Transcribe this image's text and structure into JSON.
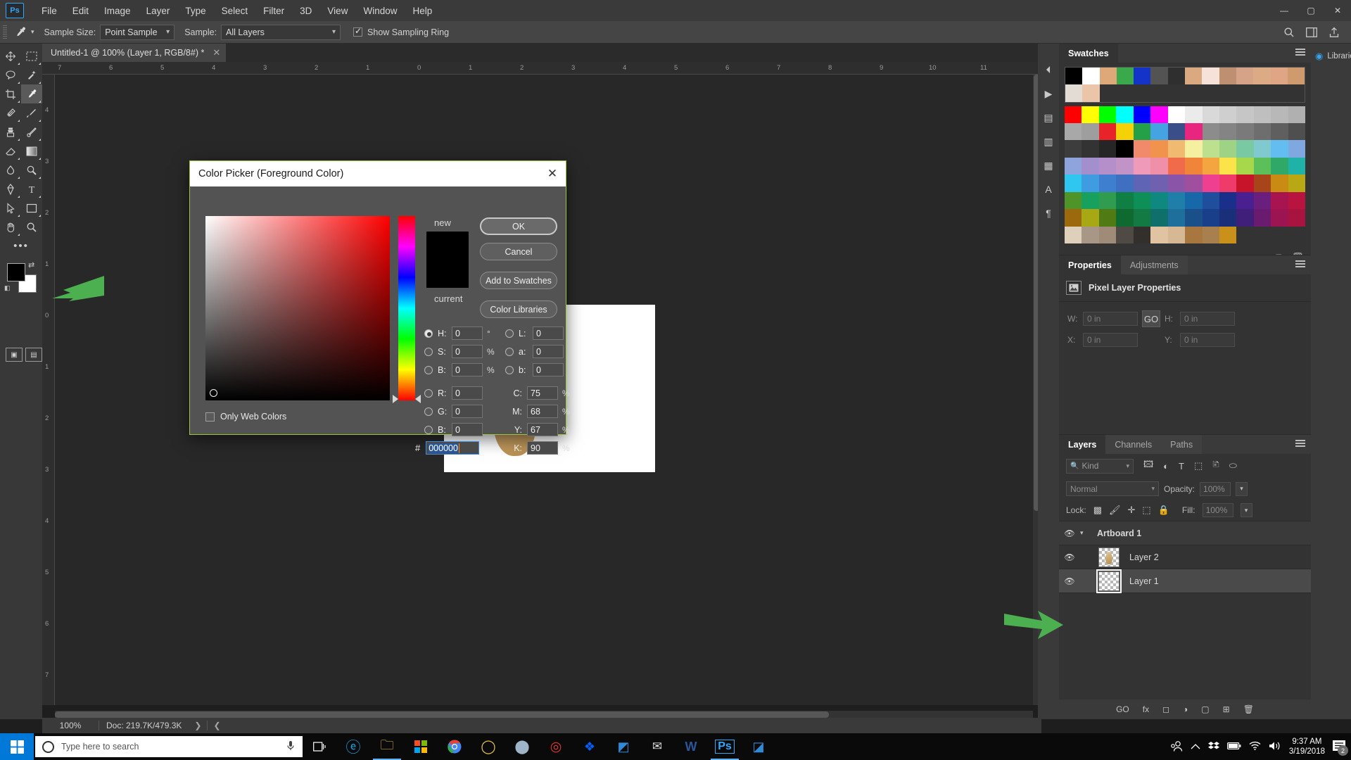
{
  "app": {
    "name": "Photoshop",
    "logo_text": "Ps"
  },
  "menubar": {
    "items": [
      "File",
      "Edit",
      "Image",
      "Layer",
      "Type",
      "Select",
      "Filter",
      "3D",
      "View",
      "Window",
      "Help"
    ],
    "window_controls": [
      "—",
      "▢",
      "✕"
    ]
  },
  "options_bar": {
    "sample_size_label": "Sample Size:",
    "sample_size_value": "Point Sample",
    "sample_label": "Sample:",
    "sample_value": "All Layers",
    "show_sampling_ring_label": "Show Sampling Ring",
    "show_sampling_ring_checked": true
  },
  "document": {
    "tab_title": "Untitled-1 @ 100% (Layer 1, RGB/8#) *",
    "tab_close": "✕"
  },
  "ruler": {
    "h_ticks": [
      "7",
      "6",
      "5",
      "4",
      "3",
      "2",
      "1",
      "0",
      "1",
      "2",
      "3",
      "4",
      "5",
      "6",
      "7",
      "8",
      "9",
      "10",
      "11"
    ],
    "v_ticks": [
      "4",
      "3",
      "2",
      "1",
      "0",
      "1",
      "2",
      "3",
      "4",
      "5",
      "6",
      "7"
    ]
  },
  "status_bar": {
    "zoom": "100%",
    "doc_info": "Doc: 219.7K/479.3K",
    "arrow_right": "❯",
    "arrow_left": "❮"
  },
  "color_picker": {
    "title": "Color Picker (Foreground Color)",
    "close_label": "✕",
    "new_label": "new",
    "current_label": "current",
    "new_color": "#000000",
    "current_color": "#000000",
    "buttons": [
      {
        "label": "OK",
        "primary": true
      },
      {
        "label": "Cancel",
        "primary": false
      },
      {
        "label": "Add to Swatches",
        "primary": false
      },
      {
        "label": "Color Libraries",
        "primary": false
      }
    ],
    "hsb": [
      {
        "label": "H:",
        "value": "0",
        "unit": "°",
        "selected": true
      },
      {
        "label": "S:",
        "value": "0",
        "unit": "%",
        "selected": false
      },
      {
        "label": "B:",
        "value": "0",
        "unit": "%",
        "selected": false
      }
    ],
    "rgb": [
      {
        "label": "R:",
        "value": "0",
        "unit": "",
        "selected": false
      },
      {
        "label": "G:",
        "value": "0",
        "unit": "",
        "selected": false
      },
      {
        "label": "B:",
        "value": "0",
        "unit": "",
        "selected": false
      }
    ],
    "lab": [
      {
        "label": "L:",
        "value": "0",
        "unit": "",
        "selected": false
      },
      {
        "label": "a:",
        "value": "0",
        "unit": "",
        "selected": false
      },
      {
        "label": "b:",
        "value": "0",
        "unit": "",
        "selected": false
      }
    ],
    "cmyk": [
      {
        "label": "C:",
        "value": "75",
        "unit": "%"
      },
      {
        "label": "M:",
        "value": "68",
        "unit": "%"
      },
      {
        "label": "Y:",
        "value": "67",
        "unit": "%"
      },
      {
        "label": "K:",
        "value": "90",
        "unit": "%"
      }
    ],
    "only_web_colors_label": "Only Web Colors",
    "only_web_colors_checked": false,
    "hex_hash": "#",
    "hex_value": "000000",
    "accent_border": "#9bc53d"
  },
  "swatches_panel": {
    "tab_label": "Swatches",
    "recent": [
      "#000000",
      "#ffffff",
      "#dfa878",
      "#3aa94b",
      "#1433c8",
      "#535353",
      "#2f2f2f",
      "#dba97f",
      "#f7e2da",
      "#bf8f72",
      "#d6a388",
      "#dcab85",
      "#e0a585",
      "#cf9a6e",
      "#e3dcd4",
      "#eac5a8"
    ],
    "grid": [
      [
        "#ff0000",
        "#ffff00",
        "#00ff00",
        "#00ffff",
        "#0000ff",
        "#ff00ff",
        "#ffffff",
        "#ebebeb",
        "#d9d9d9",
        "#cfcfcf",
        "#c6c6c6",
        "#bfbfbf",
        "#b8b8b8",
        "#b0b0b0"
      ],
      [
        "#a8a8a8",
        "#9e9e9e",
        "#e8242a",
        "#f5d108",
        "#24a148",
        "#44a3e0",
        "#3a4f8a",
        "#e8267f",
        "#8c8c8c",
        "#848484",
        "#7a7a7a",
        "#6e6e6e",
        "#5f5f5f",
        "#4f4f4f"
      ],
      [
        "#3d3d3d",
        "#333333",
        "#262626",
        "#000000",
        "#f08a6a",
        "#f2934d",
        "#f0bb70",
        "#f5f0a0",
        "#bde08f",
        "#9ed386",
        "#79c9a3",
        "#7fc9cf",
        "#64bdf0",
        "#7fa8e0"
      ],
      [
        "#8fa3dc",
        "#a38fcd",
        "#b48fc9",
        "#c193c6",
        "#ef9ab8",
        "#ef8fa8",
        "#ef6b49",
        "#f08438",
        "#f5a53f",
        "#fbe349",
        "#a7d84c",
        "#5cc05a",
        "#2fa868",
        "#1fb3a8"
      ],
      [
        "#2fc6f0",
        "#3f9ce0",
        "#3f7fd0",
        "#3f6fc0",
        "#5f64b5",
        "#7060b0",
        "#8a55a8",
        "#a04f9e",
        "#ef3f91",
        "#ef3a6a",
        "#c7142a",
        "#a8441a",
        "#c98b14",
        "#b8a814"
      ],
      [
        "#4f9428",
        "#17a05e",
        "#2f9c4f",
        "#0f7f44",
        "#0f8f58",
        "#0f8880",
        "#1f7fa8",
        "#1668a8",
        "#1f4f9c",
        "#1a2f8a",
        "#4a1f8f",
        "#6a1f7f",
        "#a8144f",
        "#b8143f"
      ],
      [
        "#9c6a0c",
        "#a8a814",
        "#4f7a14",
        "#0f6a2f",
        "#147a44",
        "#0f6f6a",
        "#1f6f9c",
        "#1a4f8a",
        "#1a3f8a",
        "#1a2f7a",
        "#3f1f7a",
        "#6a1a6f",
        "#9c1452",
        "#a8143f"
      ],
      [
        "#ded0bb",
        "#a89686",
        "#a08a78",
        "#504a44",
        "#332f2c",
        "#e0c3a0",
        "#d6b895",
        "#a8773f",
        "#a87f4f",
        "#c9911a",
        "",
        "",
        ""
      ]
    ]
  },
  "properties_panel": {
    "tabs": [
      "Properties",
      "Adjustments"
    ],
    "active_tab": "Properties",
    "title": "Pixel Layer Properties",
    "fields": [
      {
        "label": "W:",
        "value": "0 in"
      },
      {
        "label": "H:",
        "value": "0 in"
      },
      {
        "label": "X:",
        "value": "0 in"
      },
      {
        "label": "Y:",
        "value": "0 in"
      }
    ],
    "link_label": "GO"
  },
  "layers_panel": {
    "tabs": [
      "Layers",
      "Channels",
      "Paths"
    ],
    "active_tab": "Layers",
    "filter_placeholder": "Kind",
    "blend_mode": "Normal",
    "opacity_label": "Opacity:",
    "opacity_value": "100%",
    "lock_label": "Lock:",
    "fill_label": "Fill:",
    "fill_value": "100%",
    "rows": [
      {
        "name": "Artboard 1",
        "type": "group",
        "visible": true,
        "selected": false,
        "bold": true
      },
      {
        "name": "Layer 2",
        "type": "layer",
        "visible": true,
        "selected": false,
        "bold": false
      },
      {
        "name": "Layer 1",
        "type": "layer",
        "visible": true,
        "selected": true,
        "bold": false
      }
    ],
    "footer_icons": [
      "GO",
      "fx",
      "◻",
      "◑",
      "▢",
      "⊞",
      "🗑"
    ]
  },
  "libraries_panel": {
    "label": "Libraries"
  },
  "taskbar": {
    "search_placeholder": "Type here to search",
    "clock_time": "9:37 AM",
    "clock_date": "3/19/2018",
    "notif_count": "2"
  }
}
